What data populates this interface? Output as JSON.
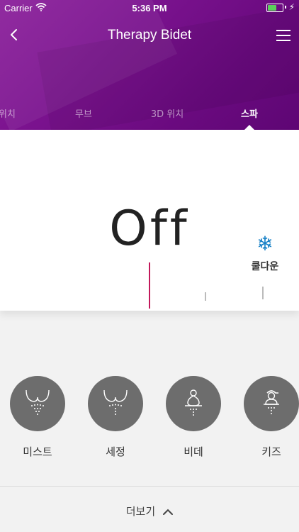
{
  "status_bar": {
    "carrier": "Carrier",
    "time": "5:36 PM",
    "battery_level": 0.6,
    "battery_color": "#5bd15b"
  },
  "nav": {
    "title": "Therapy Bidet",
    "back_icon": "chevron-left-icon",
    "menu_icon": "hamburger-menu-icon"
  },
  "tabs": [
    {
      "label": "위치"
    },
    {
      "label": "무브"
    },
    {
      "label": "3D 위치"
    },
    {
      "label": "스파",
      "active": true
    }
  ],
  "main": {
    "state_text": "Off",
    "cooldown_label": "쿨다운",
    "cooldown_icon": "snowflake-icon",
    "accent_color": "#c2185b"
  },
  "modes": [
    {
      "label": "미스트",
      "icon": "mist-icon"
    },
    {
      "label": "세정",
      "icon": "wash-icon"
    },
    {
      "label": "비데",
      "icon": "bidet-icon"
    },
    {
      "label": "키즈",
      "icon": "kids-icon"
    }
  ],
  "footer": {
    "more_label": "더보기",
    "more_icon": "chevron-up-icon"
  },
  "colors": {
    "header_purple": "#7b138f",
    "mode_circle": "#6d6d6d"
  }
}
